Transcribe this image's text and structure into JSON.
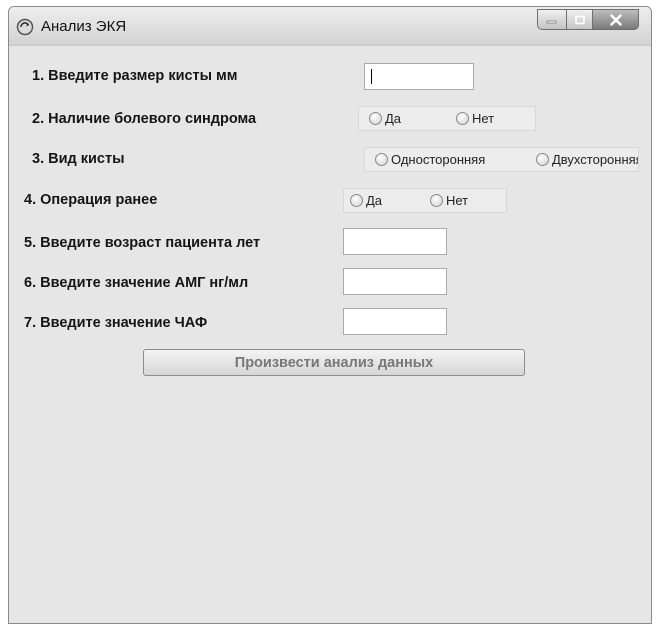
{
  "window": {
    "title": "Анализ ЭКЯ"
  },
  "form": {
    "q1": {
      "label": "1. Введите размер кисты мм",
      "value": ""
    },
    "q2": {
      "label": "2. Наличие болевого синдрома",
      "options": [
        "Да",
        "Нет"
      ]
    },
    "q3": {
      "label": "3. Вид кисты",
      "options": [
        "Односторонняя",
        "Двухсторонняя"
      ]
    },
    "q4": {
      "label": "4. Операция ранее",
      "options": [
        "Да",
        "Нет"
      ]
    },
    "q5": {
      "label": "5. Введите возраст пациента лет",
      "value": ""
    },
    "q6": {
      "label": "6. Введите значение АМГ нг/мл",
      "value": ""
    },
    "q7": {
      "label": "7. Введите значение ЧАФ",
      "value": ""
    }
  },
  "actions": {
    "analyze_label": "Произвести анализ данных"
  },
  "colors": {
    "window_background": "#e6e6e6",
    "close_button": "#8a8a8a"
  }
}
